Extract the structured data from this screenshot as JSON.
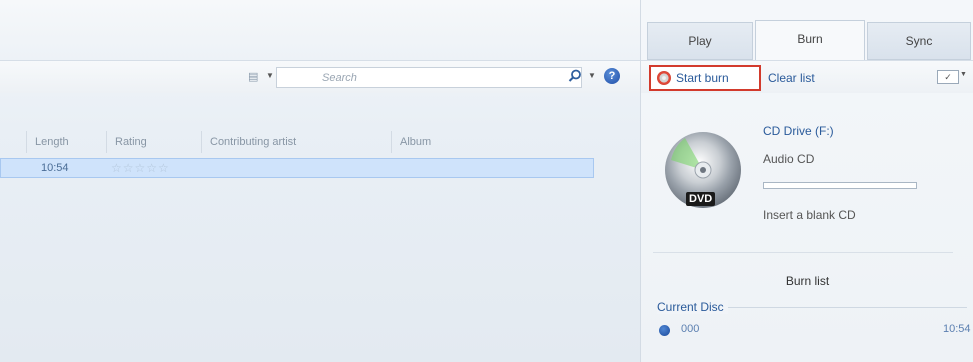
{
  "search": {
    "placeholder": "Search"
  },
  "library": {
    "columns": [
      "Length",
      "Rating",
      "Contributing artist",
      "Album"
    ],
    "selected_track": {
      "length": "10:54",
      "rating_stars": "☆☆☆☆☆"
    }
  },
  "tabs": [
    "Play",
    "Burn",
    "Sync"
  ],
  "active_tab": "Burn",
  "burn_toolbar": {
    "start_burn_label": "Start burn",
    "clear_list_label": "Clear list"
  },
  "drive": {
    "name": "CD Drive (F:)",
    "media_type": "Audio CD",
    "disc_badge": "DVD",
    "message": "Insert a blank CD",
    "progress": 0
  },
  "burn_list": {
    "title": "Burn list",
    "current_disc_label": "Current Disc",
    "items": [
      {
        "name": "000",
        "duration": "10:54"
      }
    ]
  },
  "colors": {
    "highlight_border": "#d23a2c",
    "link": "#2a5a9a",
    "selection": "#cfe3fb"
  }
}
